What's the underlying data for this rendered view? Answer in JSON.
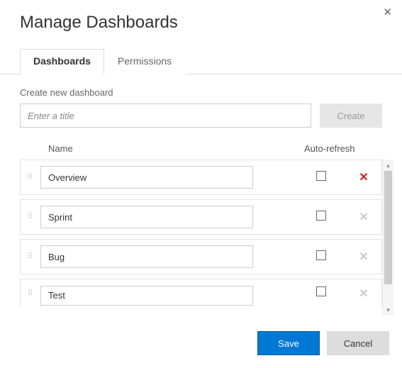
{
  "dialog": {
    "title": "Manage Dashboards"
  },
  "tabs": [
    {
      "label": "Dashboards",
      "active": true
    },
    {
      "label": "Permissions",
      "active": false
    }
  ],
  "create": {
    "label": "Create new dashboard",
    "placeholder": "Enter a title",
    "button": "Create"
  },
  "columns": {
    "name": "Name",
    "refresh": "Auto-refresh"
  },
  "dashboards": [
    {
      "name": "Overview",
      "autoRefresh": false,
      "deletable": true
    },
    {
      "name": "Sprint",
      "autoRefresh": false,
      "deletable": false
    },
    {
      "name": "Bug",
      "autoRefresh": false,
      "deletable": false
    },
    {
      "name": "Test",
      "autoRefresh": false,
      "deletable": false
    }
  ],
  "footer": {
    "save": "Save",
    "cancel": "Cancel"
  },
  "icons": {
    "close": "✕",
    "delete": "✕",
    "grip": "⋮⋮",
    "up": "▴",
    "down": "▾"
  }
}
